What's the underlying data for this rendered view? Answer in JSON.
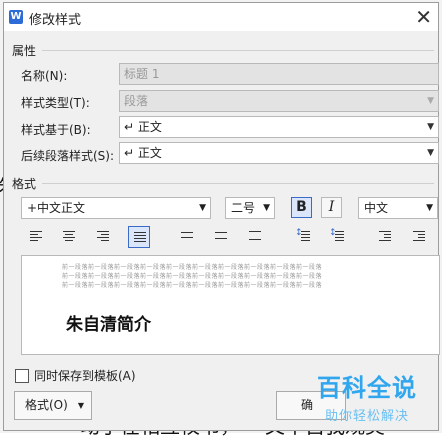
{
  "dialog": {
    "title": "修改样式",
    "app_icon": "W",
    "close_glyph": "✕"
  },
  "properties": {
    "section_label": "属性",
    "name_label": "名称(N):",
    "name_value": "标题 1",
    "style_type_label": "样式类型(T):",
    "style_type_value": "段落",
    "based_on_label": "样式基于(B):",
    "based_on_value": "↵ 正文",
    "next_style_label": "后续段落样式(S):",
    "next_style_value": "↵ 正文"
  },
  "format": {
    "section_label": "格式",
    "font_value": "+中文正文",
    "size_value": "二号",
    "bold_label": "B",
    "italic_label": "I",
    "script_value": "中文"
  },
  "preview": {
    "filler_line": "前一段落前一段落前一段落前一段落前一段落前一段落前一段落前一段落前一段落前一段落",
    "heading": "朱自清简介"
  },
  "footer": {
    "save_to_template_label": "同时保存到模板(A)",
    "format_button_label": "格式(O)",
    "format_button_arrow": "▼",
    "ok_button_label": "确"
  },
  "watermark": {
    "main": "百科全说",
    "sub": "助你轻松解决"
  },
  "background_doc": {
    "glyph_1": "朱",
    "glyph_2": "动手在相互校书，",
    "glyph_3": "文中自我观美"
  },
  "colors": {
    "accent": "#3a6bc9",
    "watermark": "#30a6ee"
  }
}
